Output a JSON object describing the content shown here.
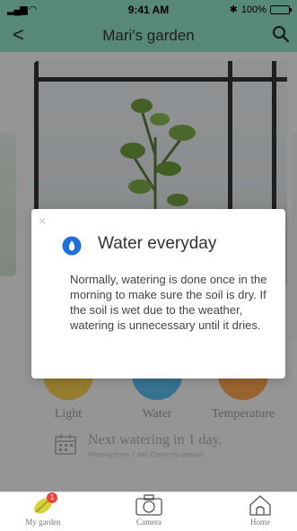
{
  "status_bar": {
    "time": "9:41 AM",
    "battery_pct": "100%"
  },
  "nav": {
    "title": "Mari's garden"
  },
  "stats": [
    {
      "label": "Light",
      "color": "#f2c94c"
    },
    {
      "label": "Water",
      "color": "#56b8e8"
    },
    {
      "label": "Temperature",
      "color": "#f5a04b"
    }
  ],
  "watering": {
    "headline": "Next watering in 1 day.",
    "sub": "Watering every 7 day. Check my calendar."
  },
  "tabs": [
    {
      "label": "My garden",
      "badge": "1"
    },
    {
      "label": "Camera"
    },
    {
      "label": "Home"
    }
  ],
  "dialog": {
    "close": "×",
    "title": "Water everyday",
    "body": "Normally, watering is done once in the morning to make sure the soil is dry. If the soil is wet due to the weather, watering is unnecessary until it dries."
  },
  "colors": {
    "header": "#8fdcc1",
    "accent_blue": "#1e6fd9",
    "badge_red": "#e8423b"
  }
}
